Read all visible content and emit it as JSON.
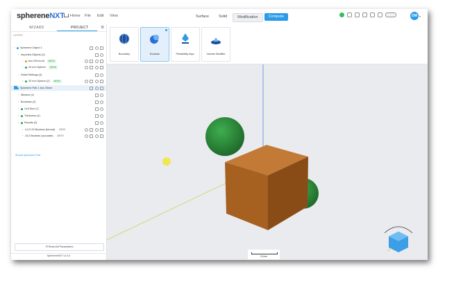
{
  "app": {
    "logo_main": "spherene",
    "logo_accent": "NXT"
  },
  "menu": {
    "home": "Home",
    "file": "File",
    "edit": "Edit",
    "view": "View"
  },
  "mode_tabs": [
    {
      "label": "Surface",
      "state": "normal"
    },
    {
      "label": "Solid",
      "state": "normal"
    },
    {
      "label": "Modification",
      "state": "active"
    },
    {
      "label": "Compute",
      "state": "primary"
    }
  ],
  "user": {
    "initials": "DM"
  },
  "panel": {
    "tab_wizard": "WIZARD",
    "tab_project": "PROJECT",
    "section_label": "LAYERS",
    "rows": [
      {
        "text": "Spherene Object 1",
        "indent": 0,
        "icon_color": "#2b9be8",
        "badge": ""
      },
      {
        "text": "Imported Objects (2)",
        "indent": 1,
        "icon_color": "",
        "badge": ""
      },
      {
        "text": "box 20mm stl",
        "indent": 2,
        "icon_color": "#e2902b",
        "badge": "MESH"
      },
      {
        "text": "20 mm Sphere",
        "indent": 2,
        "icon_color": "#2aa24a",
        "badge": "MESH"
      },
      {
        "text": "Detail Settings (4)",
        "indent": 1,
        "icon_color": "",
        "badge": ""
      },
      {
        "text": "20 mm Sphere (2)",
        "indent": 2,
        "icon_color": "#2aa24a",
        "badge": "MESH"
      },
      {
        "text": "Spherene Part 1 box 20mm",
        "indent": 0,
        "icon_color": "#2b9be8",
        "badge": "",
        "selected": true
      },
      {
        "text": "Meshes (1)",
        "indent": 1,
        "icon_color": "",
        "badge": ""
      },
      {
        "text": "Booleans (2)",
        "indent": 1,
        "icon_color": "",
        "badge": ""
      },
      {
        "text": "Cell Size (7)",
        "indent": 1,
        "icon_color": "#2aa24a",
        "badge": ""
      },
      {
        "text": "Thickness (1)",
        "indent": 1,
        "icon_color": "#2aa24a",
        "badge": ""
      },
      {
        "text": "Results (2)",
        "indent": 1,
        "icon_color": "#2aa24a",
        "badge": ""
      },
      {
        "text": "4,2,5 20 Boolean (format)",
        "indent": 2,
        "icon_color": "",
        "badge": "MESH"
      },
      {
        "text": "10,5 Boolean (accurate)",
        "indent": 2,
        "icon_color": "",
        "badge": "MESH"
      }
    ],
    "add_link": "Add Spherene Part",
    "reset_button": "Reset All Parameters",
    "version": "SphereneNXT v1.0.0"
  },
  "tools": [
    {
      "label": "Boundary",
      "icon": "globe-icon",
      "selected": false
    },
    {
      "label": "Boolean",
      "icon": "boolean-icon",
      "selected": true
    },
    {
      "label": "Printability Impr.",
      "icon": "printability-icon",
      "selected": false
    },
    {
      "label": "Volume Modifier",
      "icon": "volume-icon",
      "selected": false
    }
  ],
  "scale_bar": {
    "label": "10 mm"
  },
  "colors": {
    "accent": "#2b9be8",
    "cube": "#b8682a",
    "sphere": "#2f8f3d",
    "viewport": "#e9ebef"
  }
}
